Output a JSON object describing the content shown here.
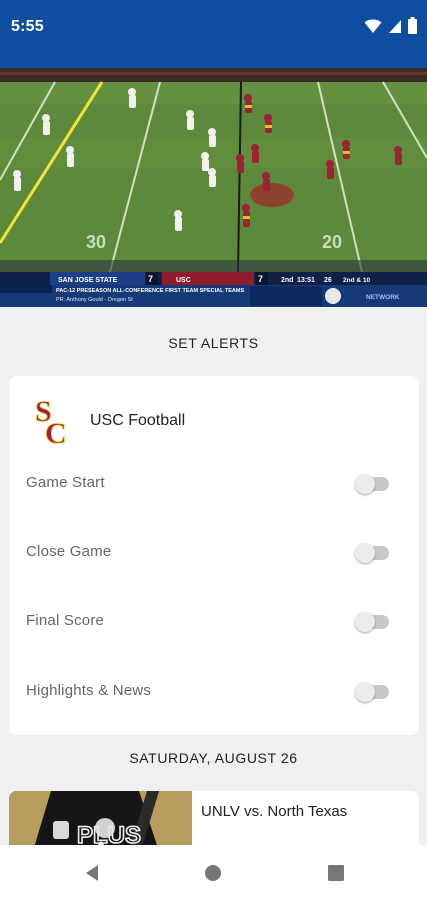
{
  "status_bar": {
    "time": "5:55",
    "wifi_icon": "wifi-icon",
    "signal_icon": "signal-icon",
    "battery_icon": "battery-icon",
    "color": "#0d4ea0"
  },
  "video": {
    "scorebug": {
      "away_team": "SAN JOSE STATE",
      "away_score": "7",
      "home_team": "USC",
      "home_score": "7",
      "quarter": "2nd",
      "clock": "13:51",
      "play_clock": "26",
      "down_distance": "2nd & 10",
      "ticker_title": "PAC-12 PRESEASON ALL-CONFERENCE FIRST TEAM SPECIAL TEAMS",
      "ticker_sub": "PR: Anthony Gould - Oregon St",
      "network": "NETWORK"
    },
    "yard_markers": [
      "30",
      "20"
    ]
  },
  "alerts_title": "SET ALERTS",
  "team": {
    "name": "USC Football",
    "logo": "usc-sc-logo",
    "logo_color": "#9d2235",
    "logo_accent": "#f1b82d"
  },
  "alerts": [
    {
      "label": "Game Start",
      "enabled": false
    },
    {
      "label": "Close Game",
      "enabled": false
    },
    {
      "label": "Final Score",
      "enabled": false
    },
    {
      "label": "Highlights & News",
      "enabled": false
    }
  ],
  "schedule_date": "SATURDAY, AUGUST 26",
  "games": [
    {
      "title": "UNLV vs. North Texas",
      "thumb_text": "PLUS"
    }
  ],
  "nav": {
    "back_icon": "back-triangle-icon",
    "home_icon": "home-circle-icon",
    "recents_icon": "recents-square-icon"
  }
}
